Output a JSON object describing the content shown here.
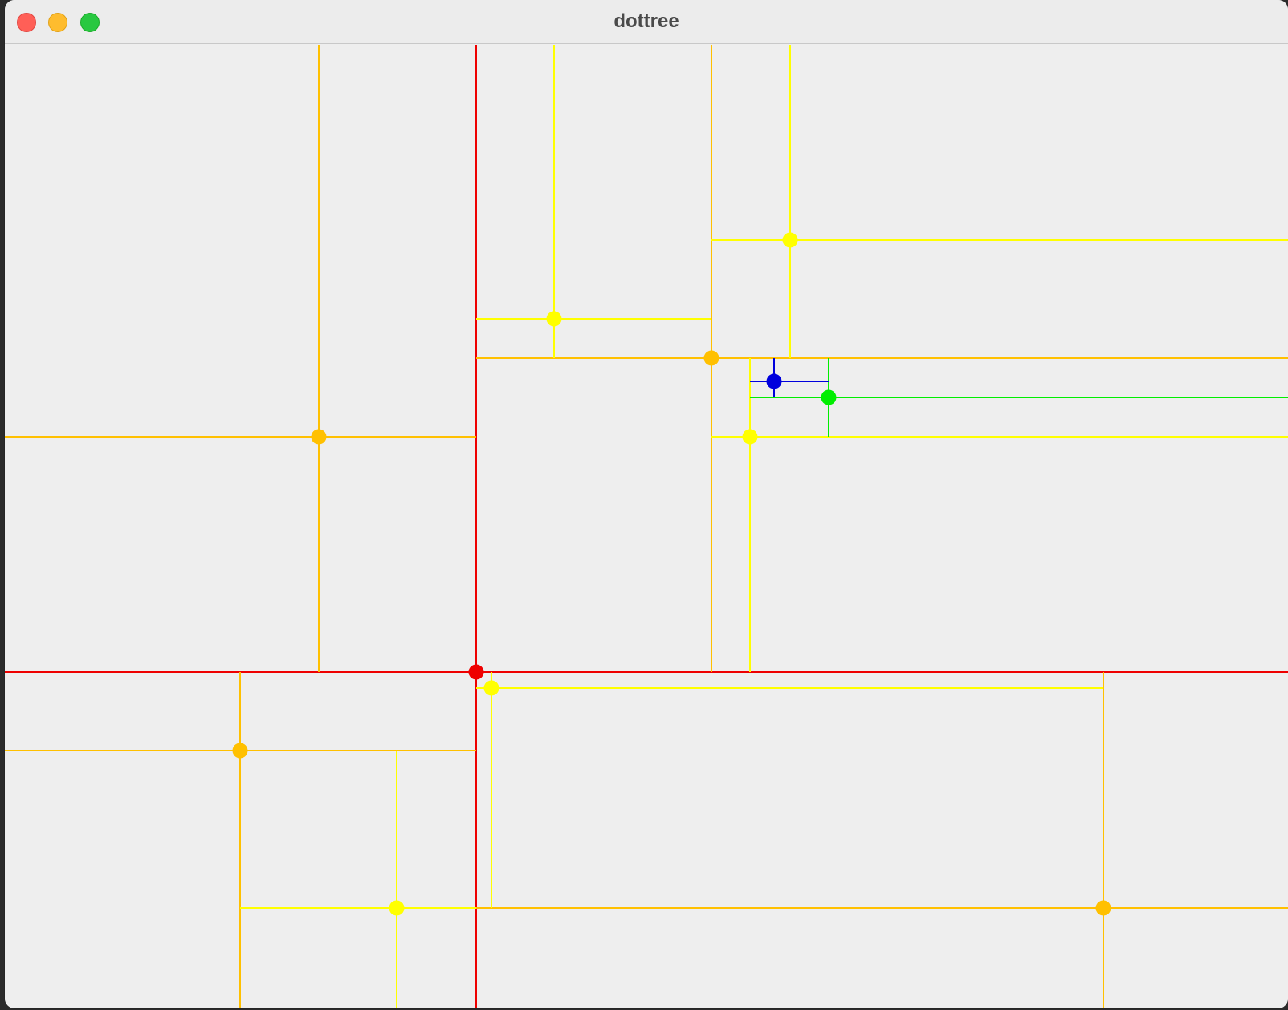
{
  "window": {
    "title": "dottree"
  },
  "colors": {
    "root": "#ee0000",
    "level1": "#ffc000",
    "level2": "#ffff00",
    "level3": "#00ee00",
    "level4": "#0000dd",
    "background": "#eeeeee"
  },
  "titlebar_buttons": [
    {
      "name": "close-button",
      "color": "#ff5f57"
    },
    {
      "name": "minimize-button",
      "color": "#febc2e"
    },
    {
      "name": "zoom-button",
      "color": "#28c840"
    }
  ]
}
